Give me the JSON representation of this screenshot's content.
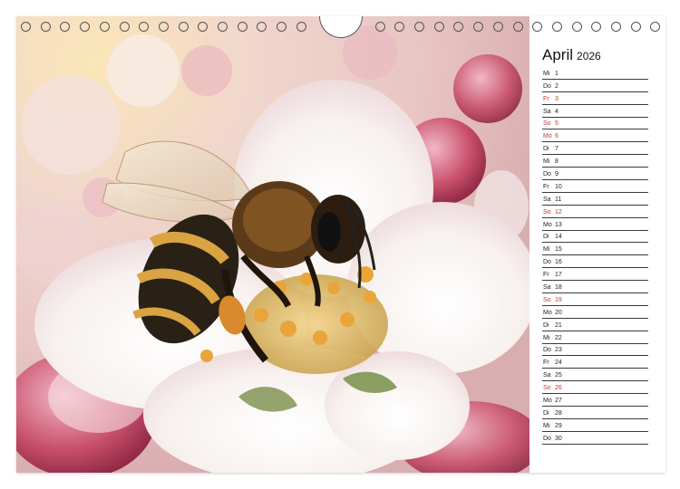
{
  "calendar": {
    "month": "April",
    "year": "2026",
    "days": [
      {
        "weekday": "Mi",
        "num": "1",
        "sunday": false
      },
      {
        "weekday": "Do",
        "num": "2",
        "sunday": false
      },
      {
        "weekday": "Fr",
        "num": "3",
        "sunday": true
      },
      {
        "weekday": "Sa",
        "num": "4",
        "sunday": false
      },
      {
        "weekday": "So",
        "num": "5",
        "sunday": true
      },
      {
        "weekday": "Mo",
        "num": "6",
        "sunday": true
      },
      {
        "weekday": "Di",
        "num": "7",
        "sunday": false
      },
      {
        "weekday": "Mi",
        "num": "8",
        "sunday": false
      },
      {
        "weekday": "Do",
        "num": "9",
        "sunday": false
      },
      {
        "weekday": "Fr",
        "num": "10",
        "sunday": false
      },
      {
        "weekday": "Sa",
        "num": "11",
        "sunday": false
      },
      {
        "weekday": "So",
        "num": "12",
        "sunday": true
      },
      {
        "weekday": "Mo",
        "num": "13",
        "sunday": false
      },
      {
        "weekday": "Di",
        "num": "14",
        "sunday": false
      },
      {
        "weekday": "Mi",
        "num": "15",
        "sunday": false
      },
      {
        "weekday": "Do",
        "num": "16",
        "sunday": false
      },
      {
        "weekday": "Fr",
        "num": "17",
        "sunday": false
      },
      {
        "weekday": "Sa",
        "num": "18",
        "sunday": false
      },
      {
        "weekday": "So",
        "num": "19",
        "sunday": true
      },
      {
        "weekday": "Mo",
        "num": "20",
        "sunday": false
      },
      {
        "weekday": "Di",
        "num": "21",
        "sunday": false
      },
      {
        "weekday": "Mi",
        "num": "22",
        "sunday": false
      },
      {
        "weekday": "Do",
        "num": "23",
        "sunday": false
      },
      {
        "weekday": "Fr",
        "num": "24",
        "sunday": false
      },
      {
        "weekday": "Sa",
        "num": "25",
        "sunday": false
      },
      {
        "weekday": "So",
        "num": "26",
        "sunday": true
      },
      {
        "weekday": "Mo",
        "num": "27",
        "sunday": false
      },
      {
        "weekday": "Di",
        "num": "28",
        "sunday": false
      },
      {
        "weekday": "Mi",
        "num": "29",
        "sunday": false
      },
      {
        "weekday": "Do",
        "num": "30",
        "sunday": false
      }
    ]
  },
  "colors": {
    "holiday": "#c0392b",
    "text": "#222222",
    "rule": "#3a3a3a"
  },
  "photo": {
    "icon": "bee-on-apple-blossom-illustration"
  }
}
